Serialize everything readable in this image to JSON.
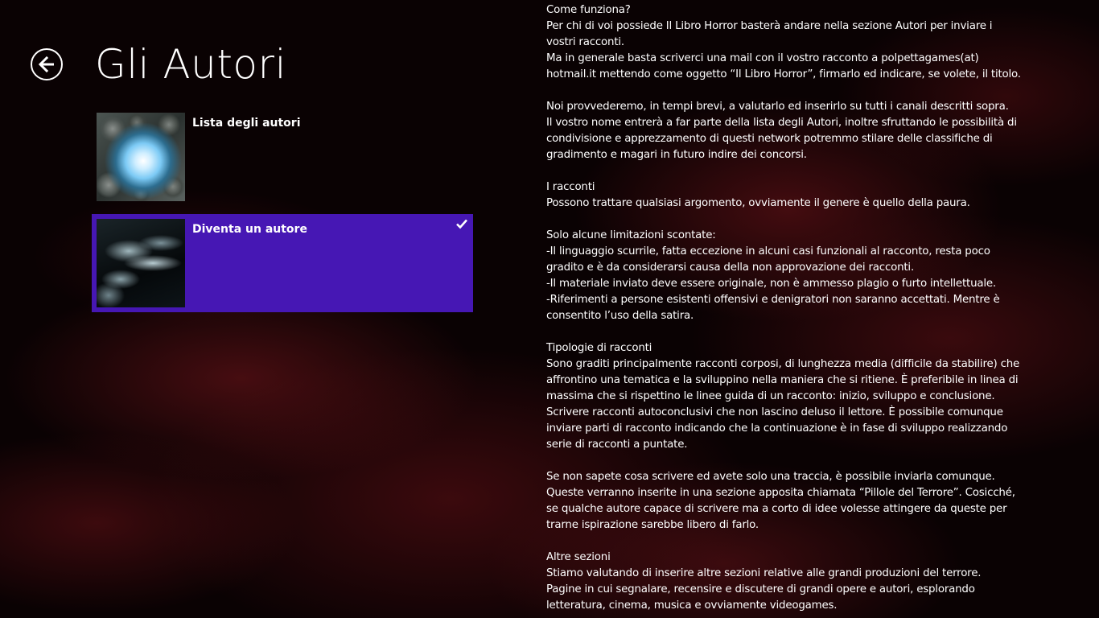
{
  "header": {
    "title": "Gli Autori"
  },
  "items": [
    {
      "title": "Lista degli autori",
      "selected": false
    },
    {
      "title": "Diventa un autore",
      "selected": true
    }
  ],
  "content": {
    "text": "Come funziona?\nPer chi di voi possiede Il Libro Horror basterà andare nella sezione Autori per inviare i vostri racconti.\nMa in generale basta scriverci una mail con il vostro racconto a polpettagames(at) hotmail.it mettendo come oggetto “Il Libro Horror”, firmarlo ed indicare, se volete, il titolo.\n\nNoi provvederemo, in tempi brevi, a valutarlo ed inserirlo su tutti i canali descritti sopra.\nIl vostro nome entrerà a far parte della lista degli Autori, inoltre sfruttando le possibilità di condivisione e apprezzamento di questi network potremmo stilare delle classifiche di gradimento e magari in futuro indire dei concorsi.\n\nI racconti\nPossono trattare qualsiasi argomento, ovviamente il genere è quello della paura.\n\nSolo alcune limitazioni scontate:\n-Il linguaggio scurrile, fatta eccezione in alcuni casi funzionali al racconto, resta poco gradito e è da considerarsi causa della non approvazione dei racconti.\n-Il materiale inviato deve essere originale, non è ammesso plagio o furto intellettuale.\n-Riferimenti a persone esistenti offensivi e denigratori non saranno accettati. Mentre è consentito l’uso della satira.\n\nTipologie di racconti\nSono graditi principalmente racconti corposi, di lunghezza media (difficile da stabilire) che affrontino una tematica e la sviluppino nella maniera che si ritiene. È preferibile in linea di massima che si rispettino le linee guida di un racconto: inizio, sviluppo e conclusione. Scrivere racconti autoconclusivi che non lascino deluso il lettore. È possibile comunque inviare parti di racconto indicando che la continuazione è in fase di sviluppo realizzando serie di racconti a puntate.\n\nSe non sapete cosa scrivere ed avete solo una traccia, è possibile inviarla comunque. Queste verranno inserite in una sezione apposita chiamata “Pillole del Terrore”. Cosicché, se qualche autore capace di scrivere ma a corto di idee volesse attingere da queste per trarne ispirazione sarebbe libero di farlo.\n\nAltre sezioni\nStiamo valutando di inserire altre sezioni relative alle grandi produzioni del terrore.\nPagine in cui segnalare, recensire e discutere di grandi opere e autori, esplorando letteratura, cinema, musica e ovviamente videogames."
  },
  "icons": {
    "back": "back-arrow-icon",
    "check": "checkmark-icon"
  },
  "colors": {
    "selected_background": "#4617b4",
    "background": "#0a0203",
    "accent_red": "#781c1c"
  }
}
